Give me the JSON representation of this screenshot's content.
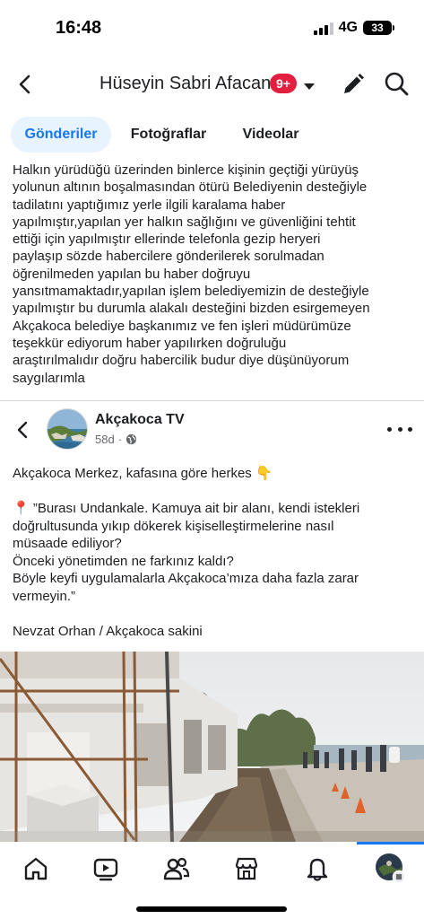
{
  "status_bar": {
    "time": "16:48",
    "network": "4G",
    "battery": "33"
  },
  "header": {
    "profile_name": "Hüseyin Sabri Afacan",
    "notification_badge": "9+",
    "icons": [
      "back-arrow-icon",
      "chevron-down-icon",
      "pencil-icon",
      "search-icon"
    ]
  },
  "tabs": [
    {
      "label": "Gönderiler",
      "active": true
    },
    {
      "label": "Fotoğraflar",
      "active": false
    },
    {
      "label": "Videolar",
      "active": false
    }
  ],
  "post": {
    "text": "Halkın yürüdüğü üzerinden binlerce kişinin geçtiği yürüyüş\nyolunun altının boşalmasından ötürü Belediyenin desteğiyle\ntadilatını yaptığımız yerle ilgili karalama haber\nyapılmıştır,yapılan yer halkın sağlığını ve güvenliğini tehtit\nettiği için yapılmıştır ellerinde telefonla gezip heryeri\npaylaşıp sözde habercilere gönderilerek sorulmadan\nöğrenilmeden yapılan bu haber doğruyu\nyansıtmamaktadır,yapılan işlem belediyemizin de desteğiyle\nyapılmıştır bu durumla alakalı desteğini bizden esirgemeyen\nAkçakoca belediye başkanımız ve fen işleri müdürümüze\nteşekkür ediyorum haber yapılırken doğruluğu\naraştırılmalıdır doğru habercilik budur diye düşünüyorum\nsaygılarımla"
  },
  "shared_post": {
    "page_name": "Akçakoca TV",
    "age": "58d",
    "separator": "·",
    "text": "Akçakoca Merkez, kafasına göre herkes 👇\n\n📍 ”Burası Undankale. Kamuya ait bir alanı, kendi istekleri\ndoğrultusunda yıkıp dökerek kişiselleştirmelerine nasıl\nmüsaade ediliyor?\nÖnceki yönetimden ne farkınız kaldı?\nBöyle keyfi uygulamalarla Akçakoca’mıza daha fazla zarar\nvermeyin.”\n\nNevzat Orhan / Akçakoca sakini",
    "image_description_icon": "photo"
  },
  "bottom_nav": {
    "items": [
      "home-icon",
      "video-icon",
      "friends-icon",
      "marketplace-icon",
      "bell-icon",
      "profile-menu-icon"
    ],
    "active_index": 5
  },
  "colors": {
    "accent": "#1877f2",
    "badge": "#e41e3f",
    "tab_active_bg": "#e7f3ff",
    "text": "#1c1e21",
    "secondary_text": "#65676b"
  }
}
